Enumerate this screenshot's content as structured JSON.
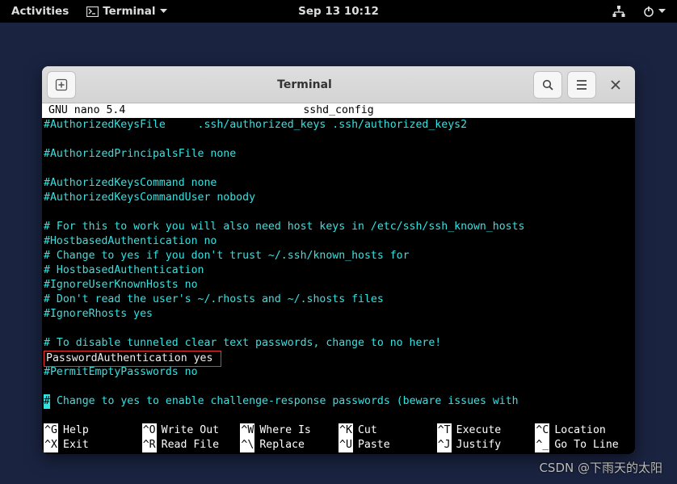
{
  "gnome": {
    "activities": "Activities",
    "app_label": "Terminal",
    "clock": "Sep 13  10:12"
  },
  "window": {
    "title": "Terminal"
  },
  "nano": {
    "header_left": "  GNU nano 5.4",
    "header_center": "sshd_config",
    "lines": [
      {
        "type": "cyan",
        "text": "#AuthorizedKeysFile     .ssh/authorized_keys .ssh/authorized_keys2"
      },
      {
        "type": "empty"
      },
      {
        "type": "cyan",
        "text": "#AuthorizedPrincipalsFile none"
      },
      {
        "type": "empty"
      },
      {
        "type": "cyan",
        "text": "#AuthorizedKeysCommand none"
      },
      {
        "type": "cyan",
        "text": "#AuthorizedKeysCommandUser nobody"
      },
      {
        "type": "empty"
      },
      {
        "type": "cyan",
        "text": "# For this to work you will also need host keys in /etc/ssh/ssh_known_hosts"
      },
      {
        "type": "cyan",
        "text": "#HostbasedAuthentication no"
      },
      {
        "type": "cyan",
        "text": "# Change to yes if you don't trust ~/.ssh/known_hosts for"
      },
      {
        "type": "cyan",
        "text": "# HostbasedAuthentication"
      },
      {
        "type": "cyan",
        "text": "#IgnoreUserKnownHosts no"
      },
      {
        "type": "cyan",
        "text": "# Don't read the user's ~/.rhosts and ~/.shosts files"
      },
      {
        "type": "cyan",
        "text": "#IgnoreRhosts yes"
      },
      {
        "type": "empty"
      },
      {
        "type": "cyan",
        "text": "# To disable tunneled clear text passwords, change to no here!"
      },
      {
        "type": "boxed_white",
        "text": "PasswordAuthentication yes "
      },
      {
        "type": "cyan",
        "text": "#PermitEmptyPasswords no"
      },
      {
        "type": "empty"
      },
      {
        "type": "cursor_cyan",
        "cursor": "#",
        "rest": " Change to yes to enable challenge-response passwords (beware issues with"
      },
      {
        "type": "empty"
      }
    ],
    "menu": [
      {
        "key": "^G",
        "label": "Help"
      },
      {
        "key": "^O",
        "label": "Write Out"
      },
      {
        "key": "^W",
        "label": "Where Is"
      },
      {
        "key": "^K",
        "label": "Cut"
      },
      {
        "key": "^T",
        "label": "Execute"
      },
      {
        "key": "^C",
        "label": "Location"
      },
      {
        "key": "^X",
        "label": "Exit"
      },
      {
        "key": "^R",
        "label": "Read File"
      },
      {
        "key": "^\\",
        "label": "Replace"
      },
      {
        "key": "^U",
        "label": "Paste"
      },
      {
        "key": "^J",
        "label": "Justify"
      },
      {
        "key": "^_",
        "label": "Go To Line"
      }
    ]
  },
  "watermark": "CSDN @下雨天的太阳"
}
